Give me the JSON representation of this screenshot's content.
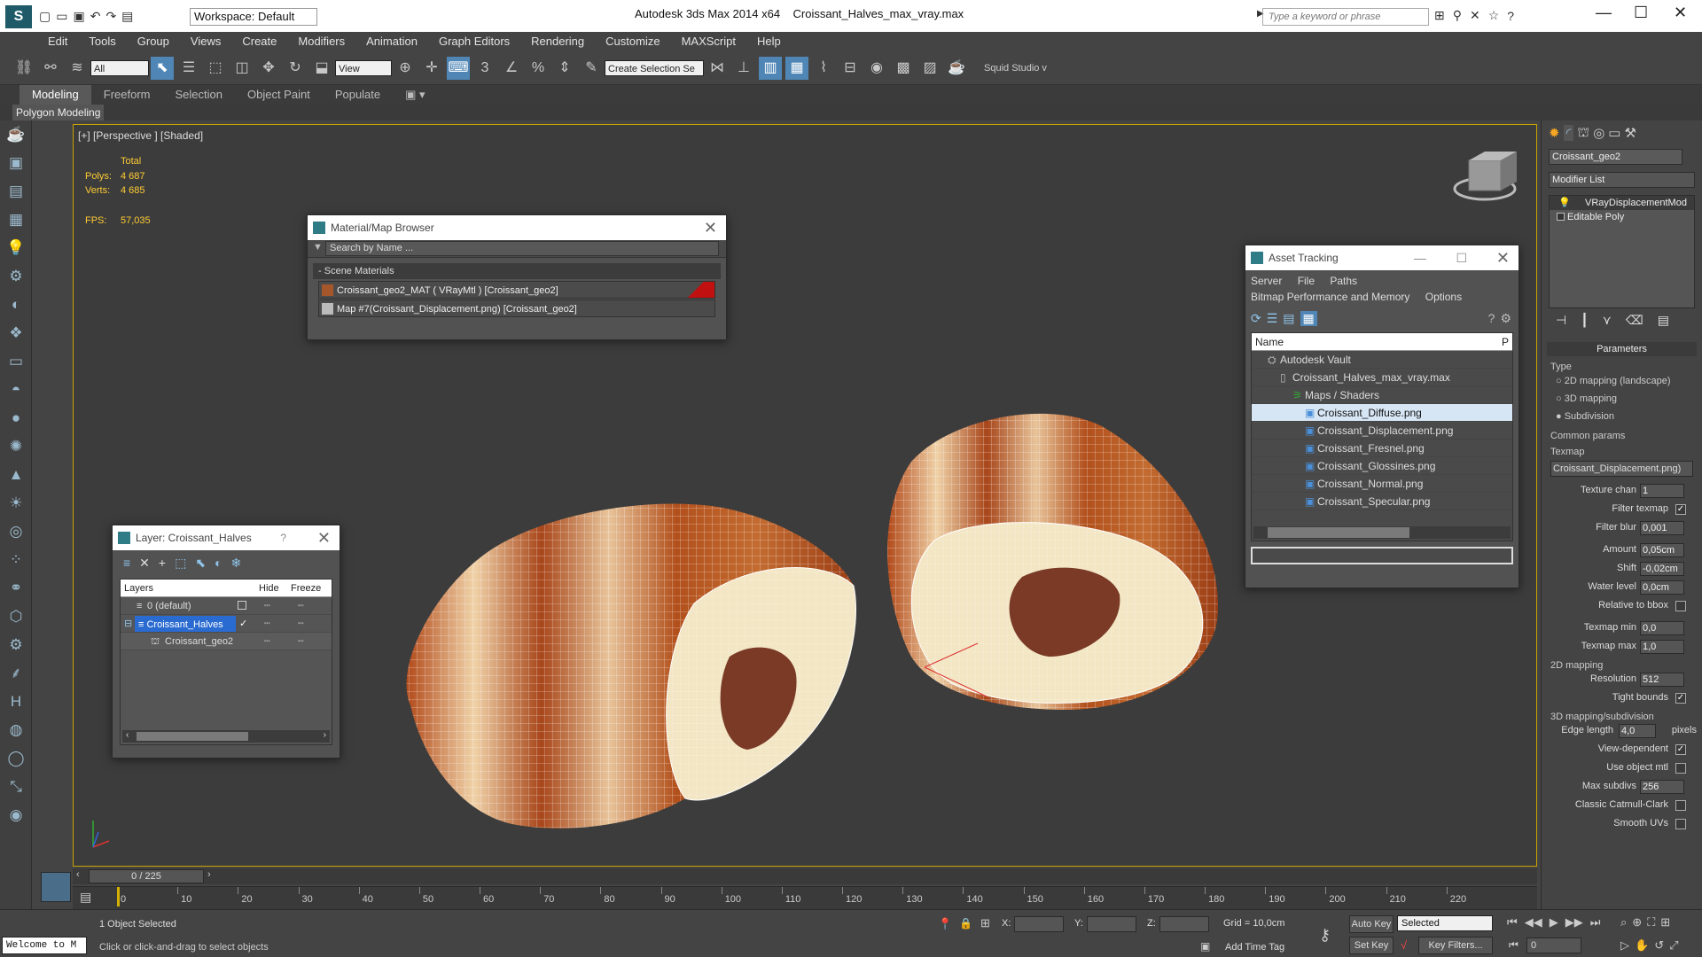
{
  "titlebar": {
    "app_icon": "3ds-max-logo",
    "workspace": "Workspace: Default",
    "app_title": "Autodesk 3ds Max  2014 x64",
    "file_title": "Croissant_Halves_max_vray.max",
    "search_placeholder": "Type a keyword or phrase"
  },
  "menu": [
    "Edit",
    "Tools",
    "Group",
    "Views",
    "Create",
    "Modifiers",
    "Animation",
    "Graph Editors",
    "Rendering",
    "Customize",
    "MAXScript",
    "Help"
  ],
  "toolbar": {
    "selection_filter": "All",
    "ref_coord": "View",
    "named_selection": "Create Selection Se",
    "squid": "Squid Studio v"
  },
  "ribbon": {
    "tabs": [
      "Modeling",
      "Freeform",
      "Selection",
      "Object Paint",
      "Populate"
    ],
    "sub": "Polygon Modeling"
  },
  "viewport": {
    "label": "[+] [Perspective ] [Shaded]",
    "total": "Total",
    "polys_label": "Polys:",
    "polys": "4 687",
    "verts_label": "Verts:",
    "verts": "4 685",
    "fps_label": "FPS:",
    "fps": "57,035"
  },
  "material_browser": {
    "title": "Material/Map Browser",
    "search": "Search by Name ...",
    "group": "Scene Materials",
    "items": [
      "Croissant_geo2_MAT  ( VRayMtl ) [Croissant_geo2]",
      "Map #7(Croissant_Displacement.png) [Croissant_geo2]"
    ]
  },
  "asset_tracking": {
    "title": "Asset Tracking",
    "menu1": [
      "Server",
      "File",
      "Paths"
    ],
    "menu2": [
      "Bitmap Performance and Memory",
      "Options"
    ],
    "col_name": "Name",
    "col_p": "P",
    "rows": [
      {
        "label": "Autodesk Vault",
        "indent": 1
      },
      {
        "label": "Croissant_Halves_max_vray.max",
        "indent": 2
      },
      {
        "label": "Maps / Shaders",
        "indent": 3
      },
      {
        "label": "Croissant_Diffuse.png",
        "indent": 4
      },
      {
        "label": "Croissant_Displacement.png",
        "indent": 4
      },
      {
        "label": "Croissant_Fresnel.png",
        "indent": 4
      },
      {
        "label": "Croissant_Glossines.png",
        "indent": 4
      },
      {
        "label": "Croissant_Normal.png",
        "indent": 4
      },
      {
        "label": "Croissant_Specular.png",
        "indent": 4
      }
    ]
  },
  "layer_window": {
    "title": "Layer: Croissant_Halves",
    "help": "?",
    "col_layers": "Layers",
    "col_hide": "Hide",
    "col_freeze": "Freeze",
    "rows": [
      "0 (default)",
      "Croissant_Halves",
      "Croissant_geo2"
    ]
  },
  "command_panel": {
    "object_name": "Croissant_geo2",
    "modifier_list": "Modifier List",
    "stack": [
      "VRayDisplacementMod",
      "Editable Poly"
    ],
    "rollout": "Parameters",
    "type_label": "Type",
    "types": [
      "2D mapping (landscape)",
      "3D mapping",
      "Subdivision"
    ],
    "common": "Common params",
    "texmap_label": "Texmap",
    "texmap": "Croissant_Displacement.png)",
    "params1": [
      {
        "label": "Texture chan",
        "value": "1"
      },
      {
        "label": "Filter texmap",
        "check": "✓"
      },
      {
        "label": "Filter blur",
        "value": "0,001"
      }
    ],
    "params2": [
      {
        "label": "Amount",
        "value": "0,05cm"
      },
      {
        "label": "Shift",
        "value": "-0,02cm"
      },
      {
        "label": "Water level",
        "value": "0,0cm"
      },
      {
        "label": "Relative to bbox",
        "check": ""
      }
    ],
    "params3": [
      {
        "label": "Texmap min",
        "value": "0,0"
      },
      {
        "label": "Texmap max",
        "value": "1,0"
      }
    ],
    "mapping2d": "2D mapping",
    "resolution_label": "Resolution",
    "resolution": "512",
    "tight_label": "Tight bounds",
    "mapping3d": "3D mapping/subdivision",
    "edge_label": "Edge length",
    "edge_value": "4,0",
    "pixels": "pixels",
    "params4": [
      {
        "label": "View-dependent",
        "check": "✓"
      },
      {
        "label": "Use object mtl",
        "check": ""
      },
      {
        "label": "Max subdivs",
        "value": "256"
      },
      {
        "label": "Classic Catmull-Clark",
        "check": ""
      },
      {
        "label": "Smooth UVs",
        "check": ""
      }
    ]
  },
  "timeline": {
    "frame": "0 / 225",
    "ticks": [
      "0",
      "10",
      "20",
      "30",
      "40",
      "50",
      "60",
      "70",
      "80",
      "90",
      "100",
      "110",
      "120",
      "130",
      "140",
      "150",
      "160",
      "170",
      "180",
      "190",
      "200",
      "210",
      "220"
    ]
  },
  "status": {
    "maxscript": "Welcome to M",
    "selected": "1 Object Selected",
    "prompt": "Click or click-and-drag to select objects",
    "x": "X:",
    "y": "Y:",
    "z": "Z:",
    "grid": "Grid = 10,0cm",
    "add_time_tag": "Add Time Tag",
    "auto_key": "Auto Key",
    "set_key": "Set Key",
    "selected_dd": "Selected",
    "key_filters": "Key Filters...",
    "frame_val": "0"
  },
  "colors": {
    "viewport_border": "#c9a300",
    "stats": "#ffcc33",
    "active_blue": "#4f86b6",
    "croissant_crust": "#b5521f",
    "croissant_inner": "#f3e6c4"
  }
}
